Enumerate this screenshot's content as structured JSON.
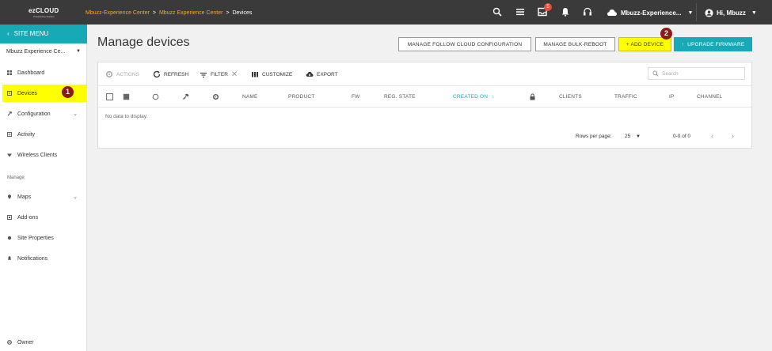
{
  "topbar": {
    "logo_text": "ezCLOUD",
    "logo_sub": "Powered by Ruckus",
    "breadcrumbs": [
      "Mbuzz-Experience Center",
      "Mbuzz Experience Center",
      "Devices"
    ],
    "crumb_sep": ">",
    "notification_count": "5",
    "account_label": "Mbuzz-Experience...",
    "user_greeting": "Hi, Mbuzz",
    "icons": [
      "search-icon",
      "list-icon",
      "inbox-icon",
      "bell-icon",
      "headset-icon",
      "cloud-icon",
      "user-icon"
    ]
  },
  "sidebar": {
    "menu_title": "SITE MENU",
    "site_name": "Mbuzz Experience Ce...",
    "items": [
      {
        "label": "Dashboard",
        "icon": "dashboard-icon"
      },
      {
        "label": "Devices",
        "icon": "devices-icon",
        "active": true
      },
      {
        "label": "Configuration",
        "icon": "wrench-icon",
        "has_children": true
      },
      {
        "label": "Activity",
        "icon": "activity-icon"
      },
      {
        "label": "Wireless Clients",
        "icon": "wifi-icon"
      }
    ],
    "manage_label": "Manage",
    "manage_items": [
      {
        "label": "Maps",
        "icon": "map-pin-icon",
        "has_children": true
      },
      {
        "label": "Add-ons",
        "icon": "addons-icon"
      },
      {
        "label": "Site Properties",
        "icon": "dot-icon"
      },
      {
        "label": "Notifications",
        "icon": "bell-icon"
      }
    ],
    "footer_item": {
      "label": "Owner",
      "icon": "gear-icon"
    }
  },
  "markers": {
    "step1": "1",
    "step2": "2"
  },
  "main": {
    "title": "Manage devices",
    "buttons": {
      "follow_cloud": "MANAGE FOLLOW CLOUD CONFIGURATION",
      "bulk_reboot": "MANAGE BULK-REBOOT",
      "add_device": "+ ADD DEVICE",
      "upgrade_firmware": "UPGRADE FIRMWARE"
    },
    "toolbar": {
      "actions": "ACTIONS",
      "refresh": "REFRESH",
      "filter": "FILTER",
      "customize": "CUSTOMIZE",
      "export": "EXPORT",
      "search_placeholder": "Search"
    },
    "columns": [
      "NAME",
      "PRODUCT",
      "FW",
      "REG. STATE",
      "CREATED ON",
      "CLIENTS",
      "TRAFFIC",
      "IP",
      "CHANNEL"
    ],
    "sorted_column": "CREATED ON",
    "empty_text": "No data to display.",
    "pagination": {
      "rows_per_page_label": "Rows per page:",
      "rows_per_page": "25",
      "range": "0-0 of 0"
    }
  },
  "colors": {
    "accent": "#17a9b6",
    "highlight": "#ffff00",
    "topbar": "#3a3a3a",
    "crumb_link": "#f5a623",
    "marker": "#8b1a1a"
  }
}
